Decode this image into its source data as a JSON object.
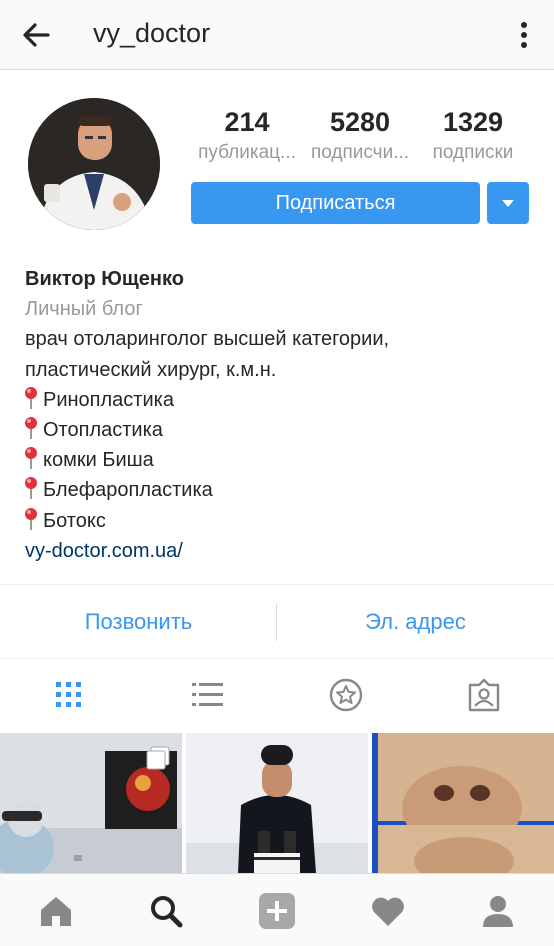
{
  "header": {
    "username": "vy_doctor",
    "back_icon": "arrow-left-icon",
    "more_icon": "vertical-dots-icon"
  },
  "profile": {
    "stats": [
      {
        "value": "214",
        "label": "публикац..."
      },
      {
        "value": "5280",
        "label": "подписчи..."
      },
      {
        "value": "1329",
        "label": "подписки"
      }
    ],
    "follow_label": "Подписаться",
    "name": "Виктор Ющенко",
    "category": "Личный блог",
    "bio_lines": [
      "врач отоларинголог высшей категории,",
      "пластический хирург, к.м.н."
    ],
    "services": [
      "Ринопластика",
      "Отопластика",
      "комки Биша",
      "Блефаропластика",
      "Ботокс"
    ],
    "link": "vy-doctor.com.ua/"
  },
  "contacts": {
    "call_label": "Позвонить",
    "email_label": "Эл. адрес"
  },
  "tabs": [
    "grid-icon",
    "list-icon",
    "star-icon",
    "tagged-icon"
  ],
  "bottom_nav": [
    "home-icon",
    "search-icon",
    "add-icon",
    "heart-icon",
    "profile-icon"
  ],
  "colors": {
    "accent": "#3897f0",
    "link": "#003569",
    "muted": "#999999",
    "text": "#262626"
  }
}
